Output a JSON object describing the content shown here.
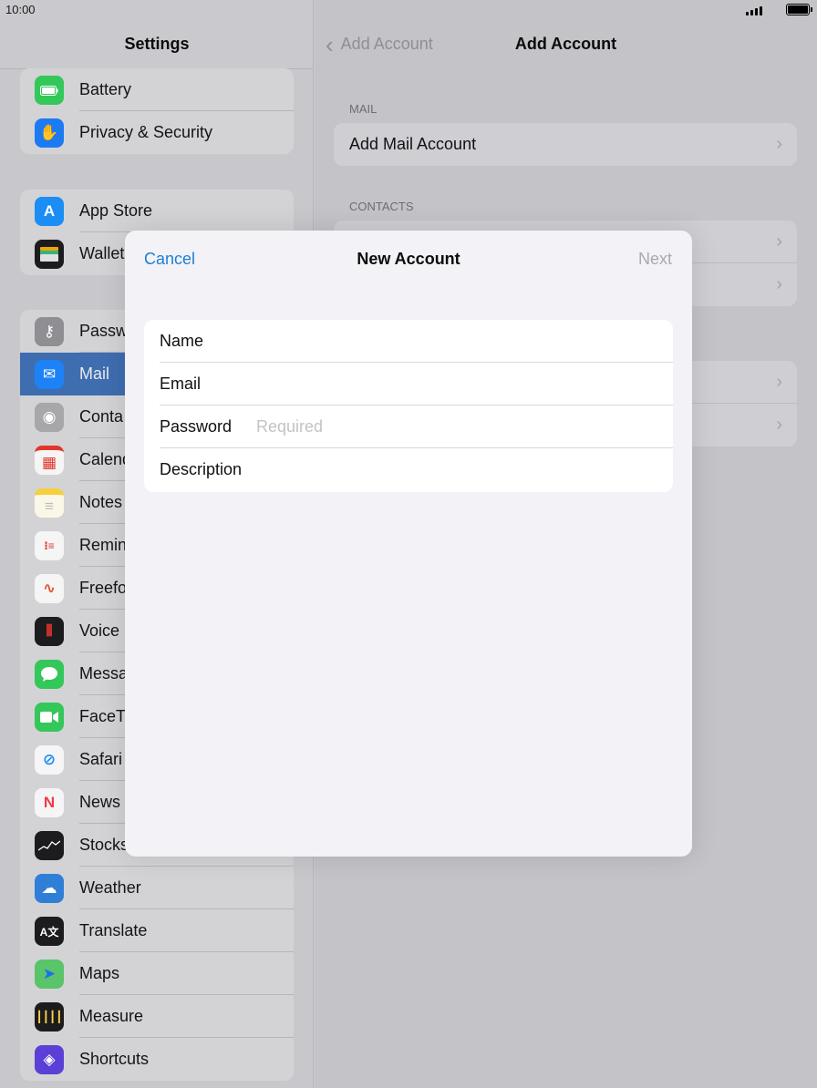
{
  "status_bar": {
    "time": "10:00"
  },
  "settings": {
    "title": "Settings",
    "groups": [
      [
        {
          "label": "Battery",
          "icon": "battery-icon",
          "color": "#34c759"
        },
        {
          "label": "Privacy & Security",
          "icon": "hand-icon",
          "color": "#1c7bf2"
        }
      ],
      [
        {
          "label": "App Store",
          "icon": "app-store-icon",
          "color": "#1a8ef5"
        },
        {
          "label": "Wallet",
          "icon": "wallet-icon",
          "color": "#1c1c1e"
        }
      ],
      [
        {
          "label": "Passw",
          "icon": "key-icon",
          "color": "#8e8e93"
        },
        {
          "label": "Mail",
          "icon": "mail-icon",
          "color": "#1c82f5",
          "selected": true
        },
        {
          "label": "Conta",
          "icon": "contacts-icon",
          "color": "#a7a7ab"
        },
        {
          "label": "Calend",
          "icon": "calendar-icon",
          "color": "#f5f5f5"
        },
        {
          "label": "Notes",
          "icon": "notes-icon",
          "color": "#f7cf3b"
        },
        {
          "label": "Remin",
          "icon": "reminders-icon",
          "color": "#f5f5f5"
        },
        {
          "label": "Freefo",
          "icon": "freeform-icon",
          "color": "#f5f5f5"
        },
        {
          "label": "Voice",
          "icon": "voice-memos-icon",
          "color": "#1c1c1e"
        },
        {
          "label": "Messa",
          "icon": "messages-icon",
          "color": "#34c759"
        },
        {
          "label": "FaceTi",
          "icon": "facetime-icon",
          "color": "#34c759"
        },
        {
          "label": "Safari",
          "icon": "safari-icon",
          "color": "#f5f5f5"
        },
        {
          "label": "News",
          "icon": "news-icon",
          "color": "#f5f5f5"
        },
        {
          "label": "Stocks",
          "icon": "stocks-icon",
          "color": "#1c1c1e"
        },
        {
          "label": "Weather",
          "icon": "weather-icon",
          "color": "#2f7fd6"
        },
        {
          "label": "Translate",
          "icon": "translate-icon",
          "color": "#1c1c1e"
        },
        {
          "label": "Maps",
          "icon": "maps-icon",
          "color": "#5ac46a"
        },
        {
          "label": "Measure",
          "icon": "measure-icon",
          "color": "#1c1c1e"
        },
        {
          "label": "Shortcuts",
          "icon": "shortcuts-icon",
          "color": "#5b3fd6"
        }
      ]
    ]
  },
  "add_account": {
    "back_label": "Add Account",
    "title": "Add Account",
    "sections": [
      {
        "header": "MAIL",
        "rows": [
          "Add Mail Account"
        ]
      },
      {
        "header": "CONTACTS",
        "rows": [
          "",
          ""
        ]
      },
      {
        "header": "",
        "rows": [
          "",
          ""
        ]
      }
    ]
  },
  "modal": {
    "cancel_label": "Cancel",
    "title": "New Account",
    "next_label": "Next",
    "fields": [
      {
        "label": "Name",
        "value": "",
        "placeholder": ""
      },
      {
        "label": "Email",
        "value": "",
        "placeholder": ""
      },
      {
        "label": "Password",
        "value": "",
        "placeholder": "Required"
      },
      {
        "label": "Description",
        "value": "",
        "placeholder": ""
      }
    ]
  },
  "colors": {
    "accent": "#1f7fd6",
    "disabled": "#a9a9ae",
    "selected_row": "#3e6db0"
  }
}
